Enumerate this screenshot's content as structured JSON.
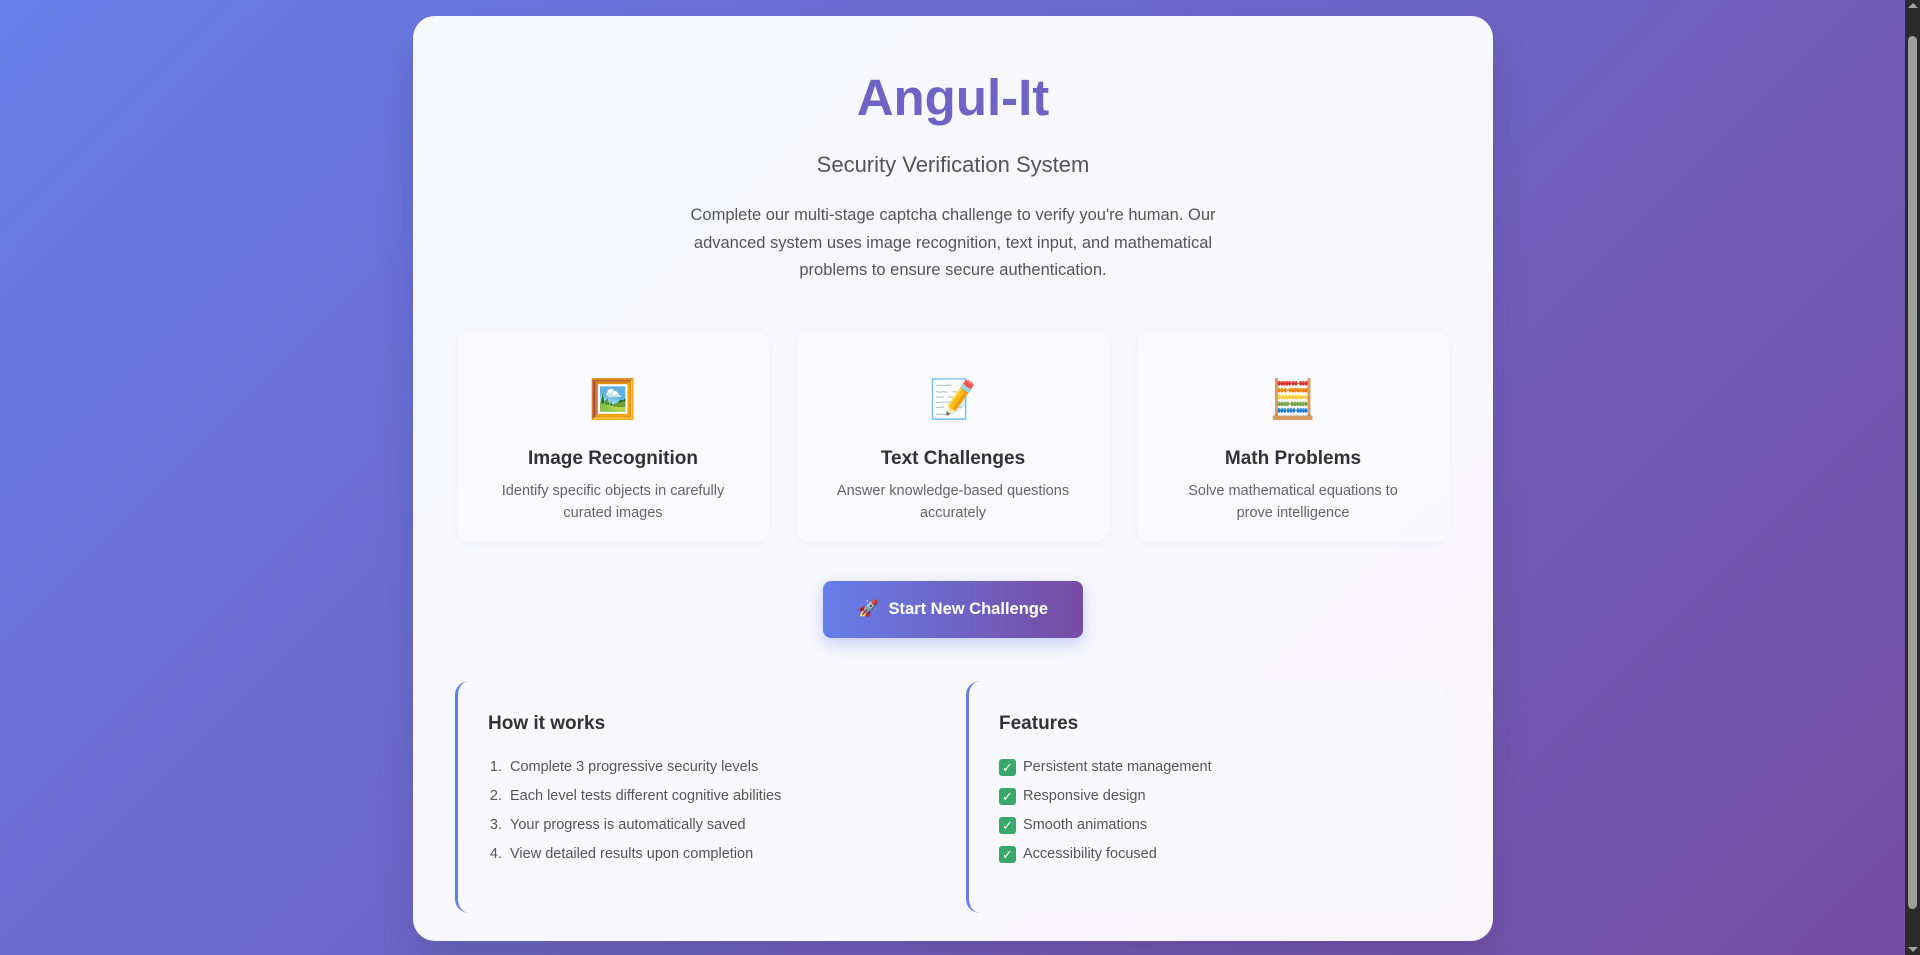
{
  "app": {
    "title": "Angul-It",
    "subtitle": "Security Verification System",
    "intro": "Complete our multi-stage captcha challenge to verify you're human. Our advanced system uses image recognition, text input, and mathematical problems to ensure secure authentication."
  },
  "features": [
    {
      "icon": "🖼️",
      "icon_name": "framed-picture-icon",
      "title": "Image Recognition",
      "description": "Identify specific objects in carefully curated images"
    },
    {
      "icon": "📝",
      "icon_name": "memo-icon",
      "title": "Text Challenges",
      "description": "Answer knowledge-based questions accurately"
    },
    {
      "icon": "🧮",
      "icon_name": "abacus-icon",
      "title": "Math Problems",
      "description": "Solve mathematical equations to prove intelligence"
    }
  ],
  "start_button": {
    "icon": "🚀",
    "icon_name": "rocket-icon",
    "label": "Start New Challenge"
  },
  "how_it_works": {
    "title": "How it works",
    "steps": [
      {
        "num": "1.",
        "text": "Complete 3 progressive security levels"
      },
      {
        "num": "2.",
        "text": "Each level tests different cognitive abilities"
      },
      {
        "num": "3.",
        "text": "Your progress is automatically saved"
      },
      {
        "num": "4.",
        "text": "View detailed results upon completion"
      }
    ]
  },
  "features_list": {
    "title": "Features",
    "items": [
      {
        "check": "✓",
        "text": "Persistent state management"
      },
      {
        "check": "✓",
        "text": "Responsive design"
      },
      {
        "check": "✓",
        "text": "Smooth animations"
      },
      {
        "check": "✓",
        "text": "Accessibility focused"
      }
    ]
  },
  "colors": {
    "accent": "#6f63c4",
    "gradient_start": "#667eea",
    "gradient_end": "#764ba2",
    "check_green": "#3aa86b"
  }
}
